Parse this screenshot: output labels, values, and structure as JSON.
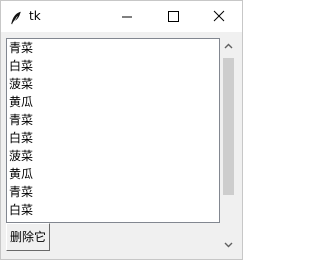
{
  "window": {
    "title": "tk"
  },
  "listbox": {
    "items": [
      "青菜",
      "白菜",
      "菠菜",
      "黄瓜",
      "青菜",
      "白菜",
      "菠菜",
      "黄瓜",
      "青菜",
      "白菜"
    ]
  },
  "actions": {
    "delete_label": "删除它"
  },
  "icons": {
    "app": "feather-icon",
    "minimize": "minimize-icon",
    "maximize": "maximize-icon",
    "close": "close-icon",
    "scroll_up": "chevron-up-icon",
    "scroll_down": "chevron-down-icon"
  },
  "colors": {
    "titlebar_bg": "#ffffff",
    "window_bg": "#f0f0f0",
    "list_bg": "#ffffff",
    "scroll_thumb": "#cdcdcd",
    "scroll_track": "#f0f0f0"
  }
}
